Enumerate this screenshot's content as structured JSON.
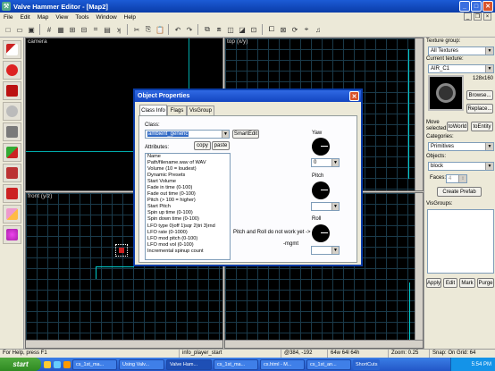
{
  "app": {
    "title": "Valve Hammer Editor - [Map2]",
    "icon": "hammer-icon"
  },
  "menu": [
    "File",
    "Edit",
    "Map",
    "View",
    "Tools",
    "Window",
    "Help"
  ],
  "toolbar_icons": [
    "new-icon",
    "open-icon",
    "save-icon",
    "grid-icon",
    "texture-lock-icon",
    "snap-icon",
    "cut-icon",
    "copy-icon",
    "paste-icon",
    "undo-icon",
    "redo-icon",
    "group-icon",
    "ungroup-icon",
    "hide-icon",
    "carve-icon",
    "entity-icon",
    "tie-icon",
    "move-to-world-icon",
    "run-icon"
  ],
  "left_tools": [
    "selection-icon",
    "magnify-icon",
    "camera-icon",
    "entity-tool-icon",
    "block-tool-icon",
    "texture-apply-icon",
    "apply-decal-icon",
    "clip-icon",
    "vertex-icon",
    "path-icon"
  ],
  "viewports": {
    "camera_label": "camera",
    "top_label": "top (x/y)",
    "front_label": "front (y/z)",
    "side_label": ""
  },
  "right_panel": {
    "texture_group_label": "Texture group:",
    "texture_group_value": "All Textures",
    "current_texture_label": "Current texture:",
    "current_texture_value": "AIR_C1",
    "texture_size": "128x160",
    "browse_button": "Browse...",
    "replace_button": "Replace...",
    "move_selected_label": "Move selected:",
    "to_world_button": "toWorld",
    "to_entity_button": "toEntity",
    "categories_label": "Categories:",
    "categories_value": "Primitives",
    "objects_label": "Objects:",
    "objects_value": "block",
    "faces_label": "Faces:",
    "faces_value": "4",
    "create_prefab_button": "Create Prefab",
    "visgroups_label": "VisGroups:",
    "apply_button": "Apply",
    "edit_button": "Edit",
    "mark_button": "Mark",
    "purge_button": "Purge"
  },
  "dialog": {
    "title": "Object Properties",
    "tabs": [
      "Class Info",
      "Flags",
      "VisGroup"
    ],
    "class_label": "Class:",
    "class_value": "ambient_generic",
    "smartedit_button": "SmartEdit",
    "attributes_label": "Attributes:",
    "copy_button": "copy",
    "paste_button": "paste",
    "attributes": [
      "Name",
      "Path/filename.wav of WAV",
      "Volume (10 = loudest)",
      "Dynamic Presets",
      "Start Volume",
      "Fade in time (0-100)",
      "Fade out time (0-100)",
      "Pitch (> 100 = higher)",
      "Start Pitch",
      "Spin up time (0-100)",
      "Spin down time (0-100)",
      "LFO type 0)off 1)sqr 2)tri 3)rnd",
      "LFO rate (0-1000)",
      "LFO mod pitch (0-100)",
      "LFO mod vol (0-100)",
      "Incremental spinup count"
    ],
    "yaw_label": "Yaw",
    "yaw_value": "0",
    "pitch_label": "Pitch",
    "pitch_value": "",
    "roll_label": "Roll",
    "roll_value": "",
    "note": "Pitch and Roll do not work yet ->",
    "mgmt": "-mgmt"
  },
  "status": {
    "help": "For Help, press F1",
    "selection": "info_player_start",
    "coords": "@384, -192",
    "size": "64w 64l 64h",
    "zoom": "Zoom: 0.25",
    "snap": "Snap: On Grid: 64"
  },
  "taskbar": {
    "start": "start",
    "tasks": [
      "cs_1st_ma...",
      "Using Valv...",
      "Valve Ham...",
      "cs_1st_ma...",
      "cs.html - M...",
      "cs_1st_an..."
    ],
    "active_index": 2,
    "tray_text": "ShortCuts",
    "clock": "5:54 PM"
  },
  "colors": {
    "titlebar": "#1c5bd6",
    "viewport_bg": "#000000",
    "grid_line": "#1a3a4a",
    "entity_white": "#ffffff",
    "entity_red": "#cc2020",
    "brush_cyan": "#00c8c8"
  }
}
